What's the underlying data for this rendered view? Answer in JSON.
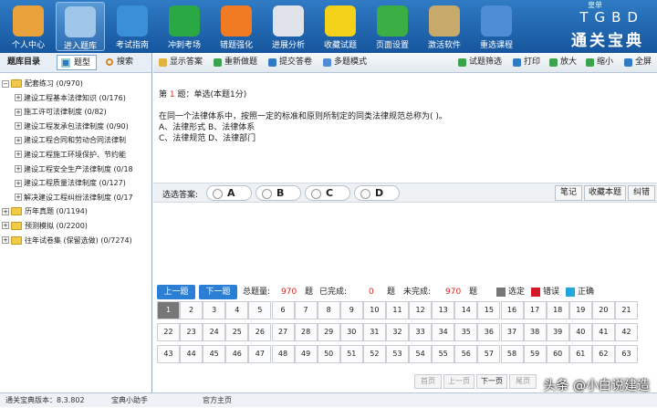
{
  "topbar": {
    "buttons": [
      {
        "label": "个人中心",
        "icon": "users-icon",
        "color": "#e9a23b"
      },
      {
        "label": "进入题库",
        "icon": "book-icon",
        "color": "#9ec7ea"
      },
      {
        "label": "考试指南",
        "icon": "globe-icon",
        "color": "#3b8fd8"
      },
      {
        "label": "冲刺考场",
        "icon": "runner-icon",
        "color": "#2aa843"
      },
      {
        "label": "错题强化",
        "icon": "notebook-icon",
        "color": "#f07b22"
      },
      {
        "label": "进展分析",
        "icon": "printer-icon",
        "color": "#e0e4ea"
      },
      {
        "label": "收藏试题",
        "icon": "star-icon",
        "color": "#f5d21a"
      },
      {
        "label": "页面设置",
        "icon": "gear-icon",
        "color": "#3cae46"
      },
      {
        "label": "激活软件",
        "icon": "lock-icon",
        "color": "#c7a96b"
      },
      {
        "label": "重选课程",
        "icon": "house-icon",
        "color": "#4f8ed6"
      }
    ],
    "brand_en": "TGBD",
    "brand_cn": "通关宝典",
    "win_ctrl": "皇单"
  },
  "left": {
    "title": "题库目录",
    "tab_type": "题型",
    "tab_search": "搜索",
    "tree": [
      {
        "label": "配套练习 (0/970)",
        "level": 0,
        "exp": "−"
      },
      {
        "label": "建设工程基本法律知识 (0/176)",
        "level": 1,
        "exp": "+"
      },
      {
        "label": "施工许可法律制度 (0/82)",
        "level": 1,
        "exp": "+"
      },
      {
        "label": "建设工程发承包法律制度 (0/90)",
        "level": 1,
        "exp": "+"
      },
      {
        "label": "建设工程合同和劳动合同法律制",
        "level": 1,
        "exp": "+"
      },
      {
        "label": "建设工程施工环境保护、节约能",
        "level": 1,
        "exp": "+"
      },
      {
        "label": "建设工程安全生产法律制度 (0/18",
        "level": 1,
        "exp": "+"
      },
      {
        "label": "建设工程质量法律制度 (0/127)",
        "level": 1,
        "exp": "+"
      },
      {
        "label": "解决建设工程纠纷法律制度 (0/17",
        "level": 1,
        "exp": "+"
      },
      {
        "label": "历年真题 (0/1194)",
        "level": 0,
        "exp": "+"
      },
      {
        "label": "预测模拟 (0/2200)",
        "level": 0,
        "exp": "+"
      },
      {
        "label": "往年试卷集 (保留选做) (0/7274)",
        "level": 0,
        "exp": "+"
      }
    ]
  },
  "toolbar": {
    "show_answer": "显示答案",
    "redo": "重新做题",
    "submit": "提交答卷",
    "multi": "多题模式",
    "filter": "试题筛选",
    "print": "打印",
    "zoom_in": "放大",
    "zoom_out": "缩小",
    "fullscreen": "全屏"
  },
  "question": {
    "prefix": "第",
    "num": "1",
    "suffix": "题：单选(本题1分)",
    "stem": "在同一个法律体系中，按照一定的标准和原则所制定的同类法律规范总称为( )。",
    "line1": "A、法律形式 B、法律体系",
    "line2": "C、法律规范 D、法律部门"
  },
  "answer": {
    "label": "选选答案:",
    "options": [
      "A",
      "B",
      "C",
      "D"
    ],
    "note": "笔记",
    "collect": "收藏本题",
    "error": "纠错"
  },
  "status": {
    "prev": "上一题",
    "next": "下一题",
    "total_label": "总题量:",
    "total": "970",
    "unit1": "题",
    "done_label": "已完成:",
    "done": "0",
    "unit2": "题",
    "undone_label": "未完成:",
    "undone": "970",
    "unit3": "题",
    "legend_selected": "选定",
    "legend_wrong": "错误",
    "legend_right": "正确"
  },
  "grid": [
    "1",
    "2",
    "3",
    "4",
    "5",
    "6",
    "7",
    "8",
    "9",
    "10",
    "11",
    "12",
    "13",
    "14",
    "15",
    "16",
    "17",
    "18",
    "19",
    "20",
    "21",
    "22",
    "23",
    "24",
    "25",
    "26",
    "27",
    "28",
    "29",
    "30",
    "31",
    "32",
    "33",
    "34",
    "35",
    "36",
    "37",
    "38",
    "39",
    "40",
    "41",
    "42",
    "43",
    "44",
    "45",
    "46",
    "47",
    "48",
    "49",
    "50",
    "51",
    "52",
    "53",
    "54",
    "55",
    "56",
    "57",
    "58",
    "59",
    "60",
    "61",
    "62",
    "63"
  ],
  "pagebar": {
    "first": "首页",
    "prev": "上一页",
    "next": "下一页",
    "last": "尾页"
  },
  "footer": {
    "version": "通关宝典版本：8.3.802",
    "helper": "宝典小助手",
    "site": "官方主页"
  },
  "watermark": "头条 @小白说建造",
  "colors": {
    "selected": "#777777",
    "wrong": "#d4182a",
    "right": "#22a6e0",
    "nav": "#2a7fd4"
  }
}
